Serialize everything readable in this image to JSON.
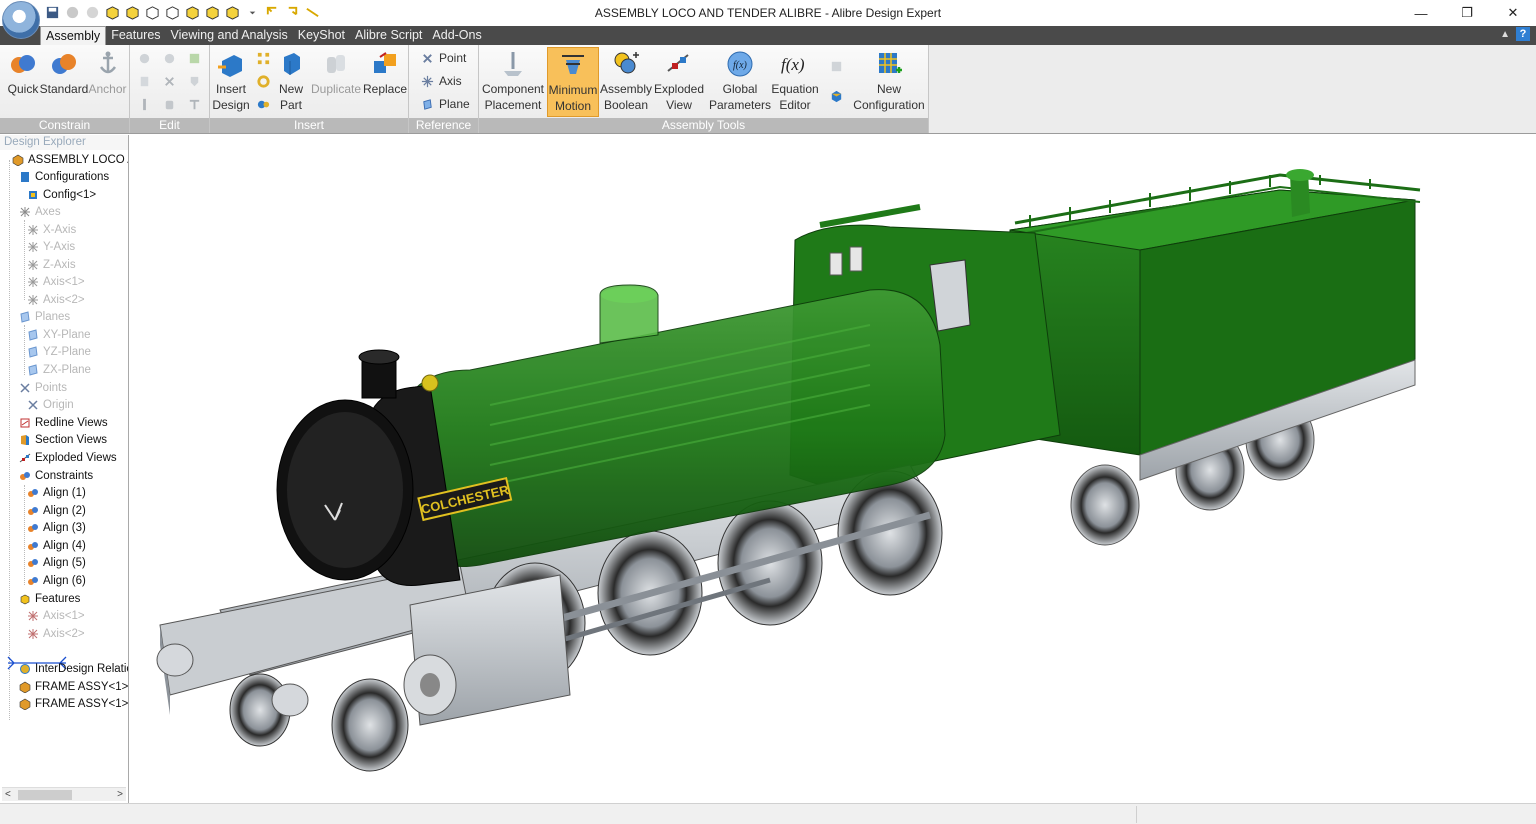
{
  "window": {
    "title": "ASSEMBLY LOCO AND TENDER ALIBRE - Alibre Design Expert",
    "controls": {
      "minimize": "—",
      "restore": "❐",
      "close": "✕"
    }
  },
  "menu": {
    "tabs": [
      "Assembly",
      "Features",
      "Viewing and Analysis",
      "KeyShot",
      "Alibre Script",
      "Add-Ons"
    ],
    "active": "Assembly"
  },
  "ribbon": {
    "groups": {
      "constrain": "Constrain",
      "edit": "Edit",
      "insert": "Insert",
      "reference": "Reference",
      "assembly_tools": "Assembly Tools"
    },
    "buttons": {
      "quick": "Quick",
      "standard": "Standard",
      "anchor": "Anchor",
      "insert_design_1": "Insert",
      "insert_design_2": "Design",
      "new_part_1": "New",
      "new_part_2": "Part",
      "duplicate": "Duplicate",
      "replace": "Replace",
      "point": "Point",
      "axis": "Axis",
      "plane": "Plane",
      "component_placement_1": "Component",
      "component_placement_2": "Placement",
      "minimum_motion_1": "Minimum",
      "minimum_motion_2": "Motion",
      "assembly_boolean_1": "Assembly",
      "assembly_boolean_2": "Boolean",
      "exploded_view_1": "Exploded",
      "exploded_view_2": "View",
      "global_parameters_1": "Global",
      "global_parameters_2": "Parameters",
      "equation_editor_1": "Equation",
      "equation_editor_2": "Editor",
      "new_configuration_1": "New",
      "new_configuration_2": "Configuration"
    }
  },
  "explorer": {
    "title": "Design Explorer",
    "root": "ASSEMBLY LOCO A",
    "configurations": "Configurations",
    "config1": "Config<1>",
    "axes": "Axes",
    "x_axis": "X-Axis",
    "y_axis": "Y-Axis",
    "z_axis": "Z-Axis",
    "axis1": "Axis<1>",
    "axis2": "Axis<2>",
    "planes": "Planes",
    "xy_plane": "XY-Plane",
    "yz_plane": "YZ-Plane",
    "zx_plane": "ZX-Plane",
    "points": "Points",
    "origin": "Origin",
    "redline_views": "Redline Views",
    "section_views": "Section Views",
    "exploded_views": "Exploded Views",
    "constraints": "Constraints",
    "align1": "Align (1)",
    "align2": "Align (2)",
    "align3": "Align (3)",
    "align4": "Align (4)",
    "align5": "Align (5)",
    "align6": "Align (6)",
    "features": "Features",
    "f_axis1": "Axis<1>",
    "f_axis2": "Axis<2>",
    "interdesign": "InterDesign Relatic",
    "frame1": "FRAME ASSY<1>",
    "frame2": "FRAME ASSY<1>"
  },
  "model": {
    "nameplate": "COLCHESTER",
    "colors": {
      "body": "#1f7a18",
      "body_dark": "#145a10",
      "smokebox": "#111111",
      "frame": "#c4c8cc"
    }
  },
  "colors": {
    "tabbar": "#4a4a4a",
    "active_tool": "#f8c05a",
    "group_label": "#b9b9b9"
  }
}
